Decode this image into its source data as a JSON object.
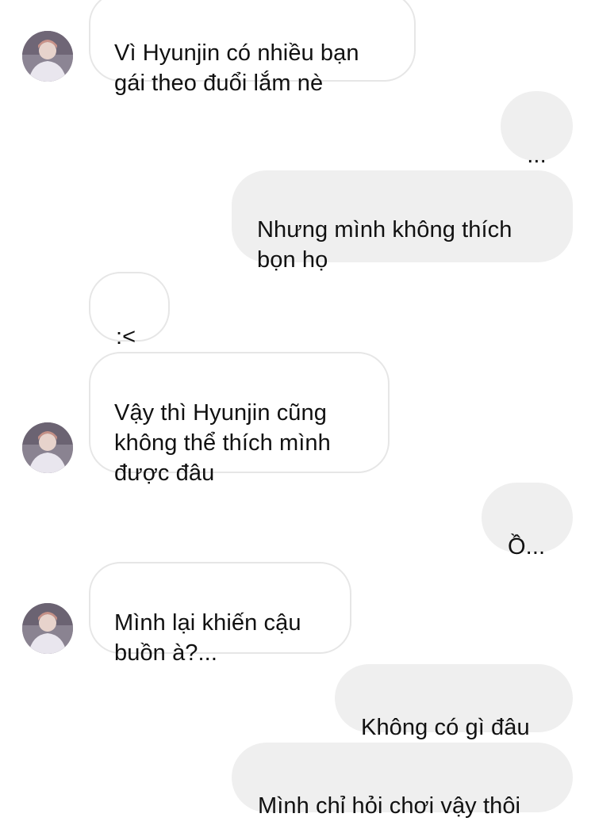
{
  "messages": [
    {
      "side": "incoming",
      "text": "Vì Hyunjin có nhiều bạn\ngái theo đuổi lắm nè",
      "avatar": true
    },
    {
      "side": "outgoing",
      "text": "..."
    },
    {
      "side": "outgoing",
      "text": "Nhưng mình không thích\nbọn họ"
    },
    {
      "side": "incoming",
      "text": ":<",
      "avatar": false
    },
    {
      "side": "incoming",
      "text": "Vậy thì Hyunjin cũng\nkhông thể thích mình\nđược đâu",
      "avatar": true
    },
    {
      "side": "outgoing",
      "text": "Ồ..."
    },
    {
      "side": "incoming",
      "text": "Mình lại khiến cậu\nbuồn à?...",
      "avatar": true
    },
    {
      "side": "outgoing",
      "text": "Không có gì đâu"
    },
    {
      "side": "outgoing",
      "text": "Mình chỉ hỏi chơi vậy thôi"
    }
  ],
  "colors": {
    "incoming_bg": "#ffffff",
    "incoming_border": "#e6e6e6",
    "outgoing_bg": "#efefef",
    "text": "#111111"
  },
  "icons": {
    "avatar": "contact-avatar-photo"
  }
}
